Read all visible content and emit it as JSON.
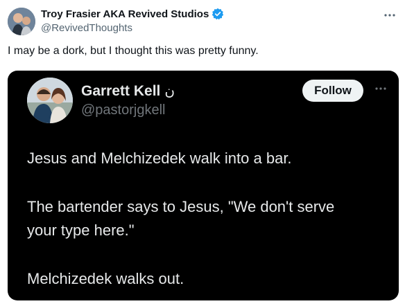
{
  "author": {
    "display_name": "Troy Frasier AKA Revived Studios",
    "handle": "@RevivedThoughts"
  },
  "tweet_text": "I may be a dork, but I thought this was pretty funny.",
  "embedded": {
    "display_name": "Garrett Kell",
    "name_glyph": "ن",
    "handle": "@pastorjgkell",
    "follow_label": "Follow",
    "lines": [
      "Jesus and Melchizedek walk into a bar.",
      "The bartender says to Jesus, \"We don't serve",
      "your type here.\"",
      "Melchizedek walks out."
    ]
  },
  "icons": {
    "verified": "verified-badge-icon",
    "more": "more-options-icon"
  },
  "colors": {
    "verified": "#1d9bf0",
    "embed_bg": "#000000",
    "follow_bg": "#eff3f4"
  }
}
